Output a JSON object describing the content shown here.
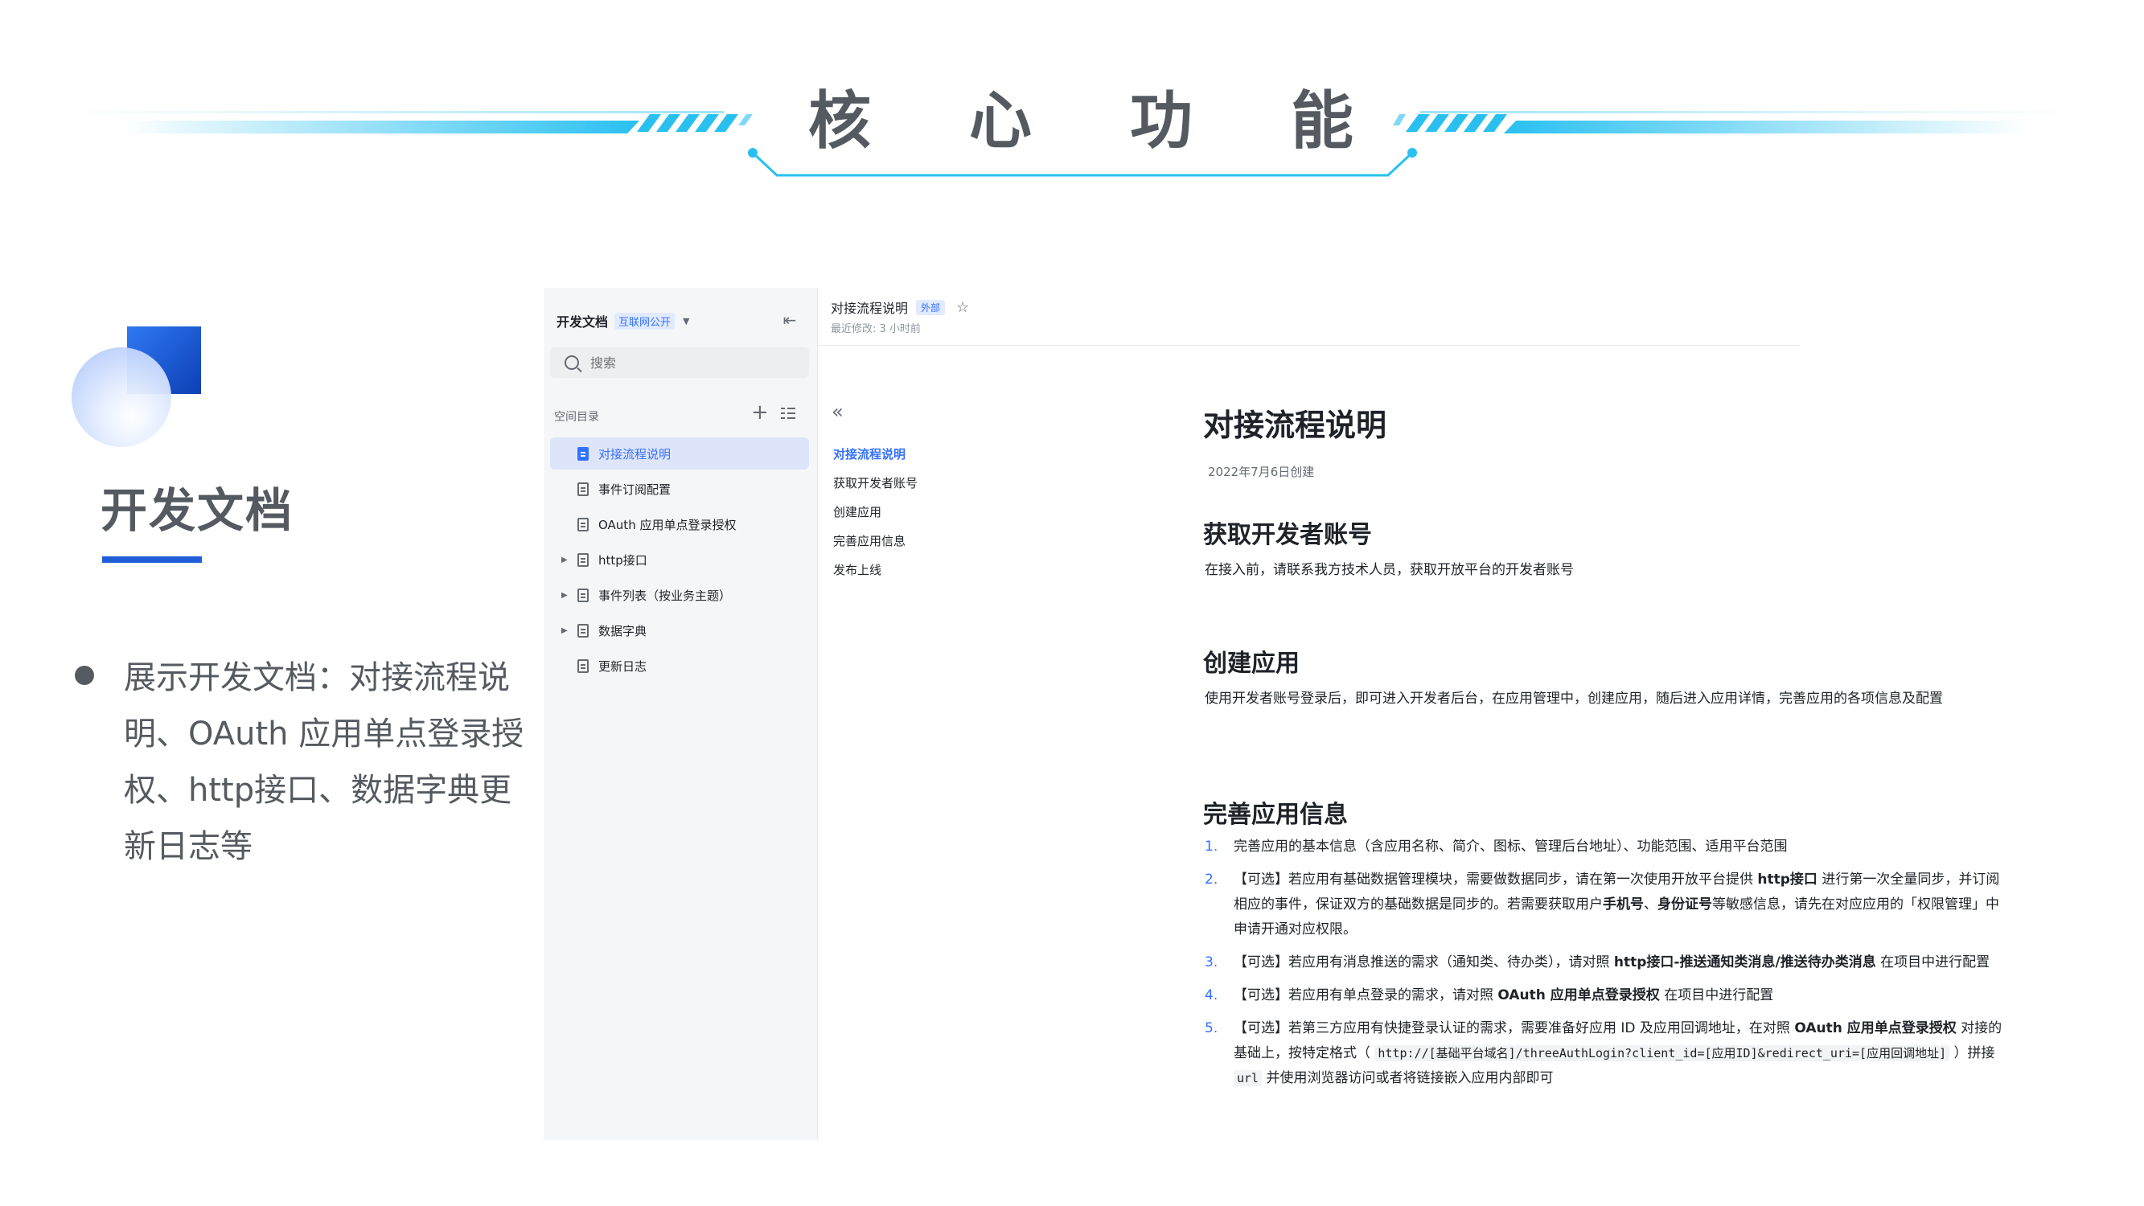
{
  "slide": {
    "heading_chars": [
      "核",
      "心",
      "功",
      "能"
    ],
    "title": "开发文档",
    "bullet": "展示开发文档：对接流程说明、OAuth 应用单点登录授权、http接口、数据字典更新日志等",
    "colors": {
      "accent": "#1f5ed8",
      "banner_cyan": "#29c0f0",
      "text": "#555a61"
    }
  },
  "app": {
    "sidebar": {
      "space_name": "开发文档",
      "space_tag": "互联网公开",
      "caret_icon": "chevron-down-icon",
      "collapse_icon": "collapse-sidebar-icon",
      "search_placeholder": "搜索",
      "section_label": "空间目录",
      "items": [
        {
          "label": "对接流程说明",
          "active": true,
          "expandable": false
        },
        {
          "label": "事件订阅配置",
          "active": false,
          "expandable": false
        },
        {
          "label": "OAuth 应用单点登录授权",
          "active": false,
          "expandable": false
        },
        {
          "label": "http接口",
          "active": false,
          "expandable": true
        },
        {
          "label": "事件列表（按业务主题）",
          "active": false,
          "expandable": true
        },
        {
          "label": "数据字典",
          "active": false,
          "expandable": true
        },
        {
          "label": "更新日志",
          "active": false,
          "expandable": false
        }
      ]
    },
    "header": {
      "doc_name": "对接流程说明",
      "badge": "外部",
      "star_icon": "star-icon",
      "last_modified": "最近修改: 3 小时前"
    },
    "outline": {
      "back_icon": "double-chevron-left-icon",
      "items": [
        "对接流程说明",
        "获取开发者账号",
        "创建应用",
        "完善应用信息",
        "发布上线"
      ]
    },
    "document": {
      "title": "对接流程说明",
      "created": "2022年7月6日创建",
      "sections": {
        "account": {
          "heading": "获取开发者账号",
          "text": "在接入前，请联系我方技术人员，获取开放平台的开发者账号"
        },
        "create": {
          "heading": "创建应用",
          "text": "使用开发者账号登录后，即可进入开发者后台，在应用管理中，创建应用，随后进入应用详情，完善应用的各项信息及配置"
        },
        "complete": {
          "heading": "完善应用信息",
          "items": [
            {
              "num": "1.",
              "text": "完善应用的基本信息（含应用名称、简介、图标、管理后台地址）、功能范围、适用平台范围"
            },
            {
              "num": "2.",
              "p1": "【可选】若应用有基础数据管理模块，需要做数据同步，请在第一次使用开放平台提供 ",
              "b1": "http接口",
              "p2": " 进行第一次全量同步，并订阅相应的事件，保证双方的基础数据是同步的。若需要获取用户",
              "b2": "手机号",
              "p3": "、",
              "b3": "身份证号",
              "p4": "等敏感信息，请先在对应应用的「权限管理」中申请开通对应权限。"
            },
            {
              "num": "3.",
              "p1": "【可选】若应用有消息推送的需求（通知类、待办类），请对照 ",
              "b1": "http接口-推送通知类消息/推送待办类消息",
              "p2": " 在项目中进行配置"
            },
            {
              "num": "4.",
              "p1": "【可选】若应用有单点登录的需求，请对照 ",
              "b1": "OAuth 应用单点登录授权",
              "p2": " 在项目中进行配置"
            },
            {
              "num": "5.",
              "p1": "【可选】若第三方应用有快捷登录认证的需求，需要准备好应用 ID 及应用回调地址，在对照 ",
              "b1": "OAuth 应用单点登录授权",
              "p2": " 对接的基础上，按特定格式（ ",
              "c1": "http://[基础平台域名]/threeAuthLogin?client_id=[应用ID]&redirect_uri=[应用回调地址]",
              "p3": " ）拼接 ",
              "c2": "url",
              "p4": " 并使用浏览器访问或者将链接嵌入应用内部即可"
            }
          ]
        }
      }
    }
  }
}
